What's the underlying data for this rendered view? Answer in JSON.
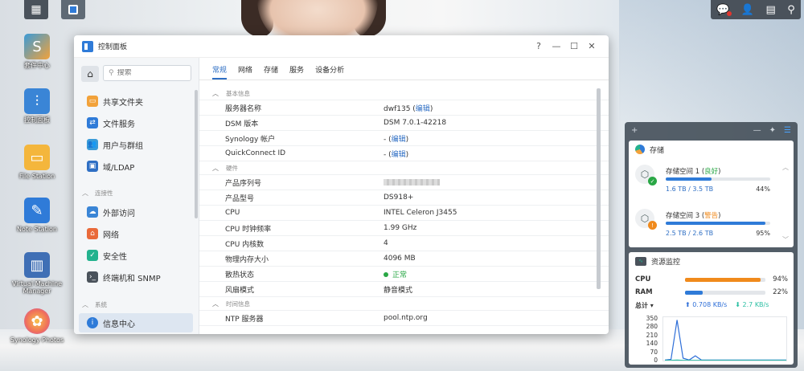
{
  "taskbar": {
    "main_menu_icon": "grid-icon",
    "control_panel_icon": "control-panel-icon"
  },
  "tray": {
    "icons": [
      "notification-icon",
      "user-icon",
      "widgets-icon",
      "search-icon"
    ]
  },
  "desktop_icons": [
    {
      "label": "套件中心",
      "icon": "package-center-icon",
      "color": "#f2a23a"
    },
    {
      "label": "控制面板",
      "icon": "control-panel-icon",
      "color": "#3a85d6"
    },
    {
      "label": "File Station",
      "icon": "folder-icon",
      "color": "#f4b63c"
    },
    {
      "label": "Note Station",
      "icon": "note-icon",
      "color": "#2f7bd8"
    },
    {
      "label": "Virtual Machine Manager",
      "icon": "vm-icon",
      "color": "#3f6fb5"
    },
    {
      "label": "Synology Photos",
      "icon": "photos-icon",
      "color": "#f06f5b"
    }
  ],
  "window": {
    "title": "控制面板",
    "controls": {
      "help": "?",
      "minimize": "—",
      "maximize": "☐",
      "close": "✕"
    }
  },
  "sidebar": {
    "search_placeholder": "搜索",
    "items_top": [
      {
        "label": "共享文件夹",
        "icon": "shared-folder-icon",
        "color": "#f2a23a"
      },
      {
        "label": "文件服务",
        "icon": "file-services-icon",
        "color": "#2f7bd8"
      },
      {
        "label": "用户与群组",
        "icon": "user-group-icon",
        "color": "#3a9bd8"
      },
      {
        "label": "域/LDAP",
        "icon": "domain-ldap-icon",
        "color": "#2f6fc4"
      }
    ],
    "group_connectivity": "连接性",
    "items_connectivity": [
      {
        "label": "外部访问",
        "icon": "external-access-icon",
        "color": "#3a85d6"
      },
      {
        "label": "网络",
        "icon": "network-icon",
        "color": "#e96a3a"
      },
      {
        "label": "安全性",
        "icon": "security-icon",
        "color": "#23b28e"
      },
      {
        "label": "终端机和 SNMP",
        "icon": "terminal-snmp-icon",
        "color": "#4a525b"
      }
    ],
    "group_system": "系统",
    "items_system": [
      {
        "label": "信息中心",
        "icon": "info-center-icon",
        "color": "#2f7bd8",
        "active": true
      }
    ]
  },
  "tabs": [
    {
      "label": "常规",
      "active": true
    },
    {
      "label": "网络"
    },
    {
      "label": "存储"
    },
    {
      "label": "服务"
    },
    {
      "label": "设备分析"
    }
  ],
  "info": {
    "section_basic": "基本信息",
    "server_name_label": "服务器名称",
    "server_name_value": "dwf135",
    "edit_label": "编辑",
    "dsm_label": "DSM 版本",
    "dsm_value": "DSM 7.0.1-42218",
    "synology_account_label": "Synology 帐户",
    "quickconnect_label": "QuickConnect ID",
    "empty_prefix": "- (",
    "paren_close": ")",
    "section_hardware": "硬件",
    "serial_label": "产品序列号",
    "model_label": "产品型号",
    "model_value": "DS918+",
    "cpu_label": "CPU",
    "cpu_value": "INTEL Celeron J3455",
    "cpu_freq_label": "CPU 时钟频率",
    "cpu_freq_value": "1.99 GHz",
    "cpu_cores_label": "CPU 内核数",
    "cpu_cores_value": "4",
    "memory_label": "物理内存大小",
    "memory_value": "4096 MB",
    "thermal_label": "散热状态",
    "thermal_value": "正常",
    "fan_label": "风扇模式",
    "fan_value": "静音模式",
    "section_time": "时间信息",
    "ntp_label": "NTP 服务器",
    "ntp_value": "pool.ntp.org"
  },
  "widgets": {
    "add_icon": "+",
    "storage": {
      "title": "存储",
      "volumes": [
        {
          "name": "存储空间 1",
          "status": "良好",
          "status_color": "#29a745",
          "used": "1.6 TB / 3.5 TB",
          "pct": "44%",
          "fraction": 0.44
        },
        {
          "name": "存储空间 3",
          "status": "警告",
          "status_color": "#f08a1c",
          "used": "2.5 TB / 2.6 TB",
          "pct": "95%",
          "fraction": 0.95
        }
      ]
    },
    "resource": {
      "title": "资源监控",
      "cpu_label": "CPU",
      "cpu_pct": "94%",
      "cpu_fraction": 0.94,
      "ram_label": "RAM",
      "ram_pct": "22%",
      "ram_fraction": 0.22,
      "total_label": "总计 ▾",
      "upload": "0.708 KB/s",
      "download": "2.7 KB/s",
      "y_ticks": [
        "350",
        "280",
        "210",
        "140",
        "70",
        "0"
      ]
    }
  },
  "chart_data": {
    "type": "line",
    "title": "",
    "ylim": [
      0,
      350
    ],
    "x": [
      0,
      1,
      2,
      3,
      4,
      5,
      6,
      7,
      8,
      9,
      10,
      11,
      12,
      13,
      14,
      15,
      16,
      17,
      18,
      19,
      20
    ],
    "series": [
      {
        "values": [
          5,
          10,
          340,
          20,
          5,
          40,
          5,
          5,
          5,
          5,
          5,
          5,
          5,
          5,
          5,
          5,
          5,
          5,
          5,
          5,
          5
        ],
        "color": "#2f6fd8"
      },
      {
        "values": [
          2,
          2,
          4,
          2,
          2,
          2,
          2,
          2,
          2,
          2,
          2,
          2,
          2,
          2,
          2,
          2,
          2,
          2,
          2,
          2,
          2
        ],
        "color": "#2bbfa3"
      }
    ]
  }
}
